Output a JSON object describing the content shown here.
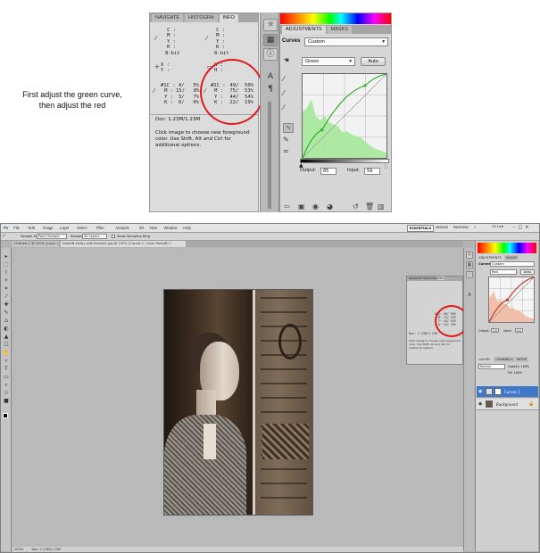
{
  "annotation": {
    "line1": "First adjust the green curve,",
    "line2": "then adjust the red"
  },
  "info_panel": {
    "tabs": [
      "NAVIGATE",
      "HISTOGRA",
      "INFO"
    ],
    "rows": {
      "c1_left": "C :\nM :\nY :\nK :\n8-bit",
      "c1_right": "C :\nM :\nY :\nK :\n8-bit",
      "xy_left": "X :\nY :",
      "wh_right": "W :\nH :",
      "num1_labels": "#1C :\nM :\nY :\nK :",
      "num1_values": "4/   5%\n15/   8%\n3/   7%\n0/   0%",
      "num2_labels": "#2C :\nM :\nY :\nK :",
      "num2_values": "49/  50%\n75/  53%\n44/  54%\n22/  19%"
    },
    "doc": "Doc: 1.23M/1.23M",
    "help": "Click image to choose new foreground color.  Use Shift, Alt and Ctrl for additional options."
  },
  "adjustments_panel": {
    "tabs": [
      "ADJUSTMENTS",
      "MASKS"
    ],
    "title": "Curves",
    "preset": "Custom",
    "channel": "Green",
    "auto": "Auto",
    "output_label": "Output:",
    "output_value": "85",
    "input_label": "Input:",
    "input_value": "59"
  },
  "curve": {
    "channel_color": "#2fae2f",
    "histogram_color": "#a6e89a",
    "points": [
      [
        0,
        0
      ],
      [
        59,
        85
      ],
      [
        190,
        220
      ],
      [
        255,
        255
      ]
    ]
  },
  "window": {
    "menu": [
      "Ps",
      "File",
      "Edit",
      "Image",
      "Layer",
      "Select",
      "Filter",
      "Analysis",
      "3D",
      "View",
      "Window",
      "Help"
    ],
    "workspaces": [
      "ESSENTIALS",
      "DESIGN",
      "PAINTING",
      "»"
    ],
    "search": "CS Live",
    "options": {
      "sample_size_label": "Sample Size:",
      "sample_size": "Point Sample",
      "sample_label": "Sample:",
      "sample": "All Layers",
      "show_ring": "Show Sampling Ring"
    },
    "doc_tabs": [
      "Untitled-1 @ 100% (Layer 1, RGB/8)",
      "IsobelN Ashby side female1.jpg @ 100% (Curves 1, Layer Mask/8) *"
    ],
    "status": "Doc: 1.23M/1.23M",
    "zoom": "100%",
    "mini_info": {
      "tabs": [
        "NAVIGATE",
        "HISTOGRA",
        "INFO"
      ],
      "num2": "#2C: 49/ 50%\n  M: 75/ 53%\n  Y: 44/ 54%\n  K: 22/ 19%",
      "doc": "Doc: 1.23M/1.23M",
      "help": "Click image to choose new foreground color.  Use Shift, Alt and Ctrl for additional options."
    },
    "right_panel": {
      "tabs": [
        "ADJUSTMENTS",
        "MASKS"
      ],
      "curves": "Curves",
      "preset": "Custom",
      "channel": "Red",
      "auto": "Auto",
      "output": "Output:",
      "output_value": "126",
      "input": "Input:",
      "input_value": "104",
      "layers_tabs": [
        "LAYERS",
        "CHANNELS",
        "PATHS"
      ],
      "blend": "Normal",
      "opacity": "Opacity: 100%",
      "fill": "Fill: 100%",
      "layers": [
        "Curves 1",
        "Background"
      ]
    }
  }
}
